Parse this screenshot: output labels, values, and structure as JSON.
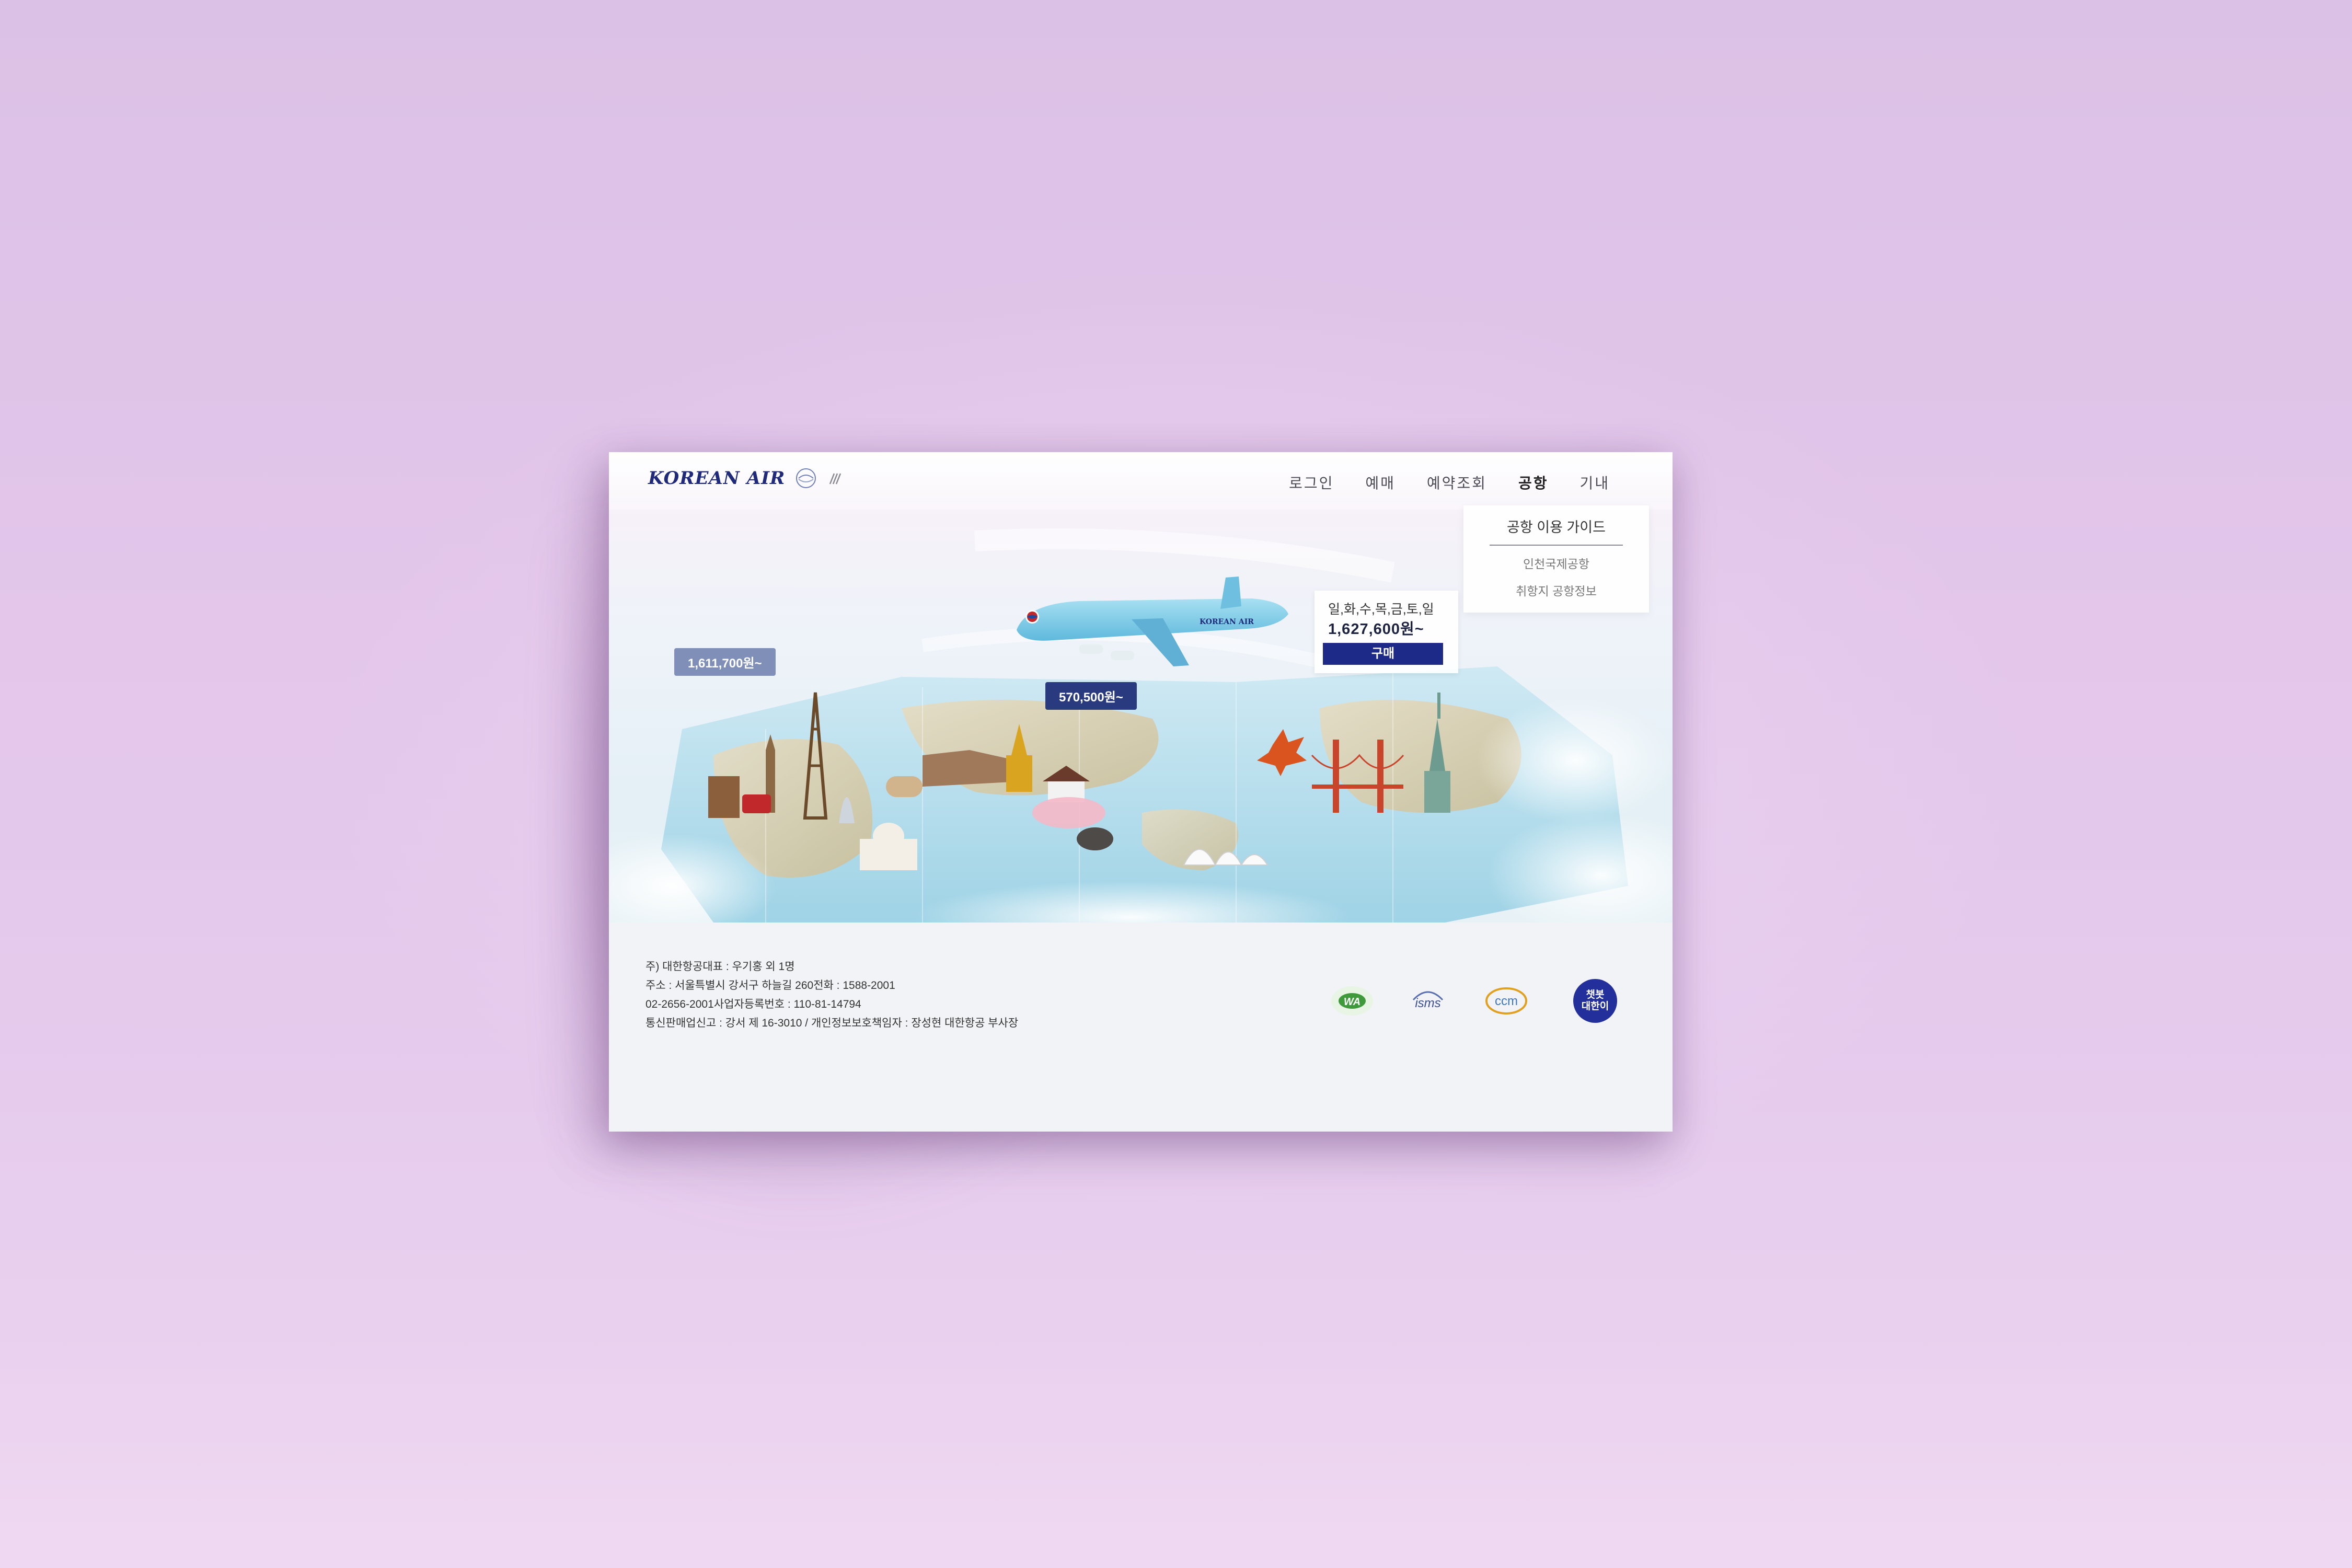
{
  "header": {
    "logo_text": "KOREAN AIR",
    "nav": [
      "로그인",
      "예매",
      "예약조회",
      "공항",
      "기내"
    ],
    "active_nav_index": 3
  },
  "dropdown": {
    "title": "공항 이용 가이드",
    "links": [
      "인천국제공항",
      "취항지 공항정보"
    ]
  },
  "hero": {
    "price_tag_europe": "1,611,700원~",
    "price_tag_asia": "570,500원~",
    "card": {
      "days": "일,화,수,목,금,토,일",
      "price": "1,627,600원~",
      "buy_label": "구매"
    },
    "plane_livery": "KOREAN AIR"
  },
  "footer": {
    "lines": [
      "주) 대한항공대표 : 우기홍 외 1명",
      "주소 : 서울특별시 강서구 하늘길 260전화 : 1588-2001",
      "02-2656-2001사업자등록번호 : 110-81-14794",
      "통신판매업신고 : 강서 제 16-3010 / 개인정보보호책임자 : 장성현 대한항공 부사장"
    ],
    "badges": [
      "WA",
      "isms",
      "ccm",
      "챗봇 대한이"
    ]
  },
  "colors": {
    "brand_navy": "#1d2a88",
    "background": "#e3c6ea",
    "sky_blue": "#7fc6e4"
  },
  "icons": [
    "korean-air-emblem-icon",
    "skyteam-icon"
  ]
}
